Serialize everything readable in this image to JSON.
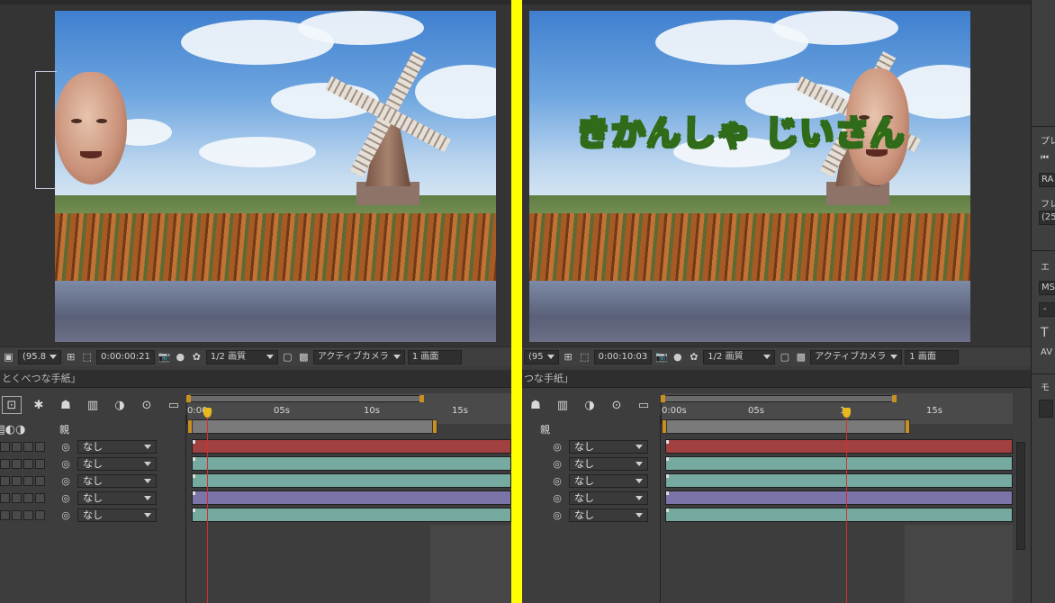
{
  "colors": {
    "separator": "#ffff00",
    "layer_red": "#a04040",
    "layer_teal": "#76aaa0",
    "layer_purple": "#7a74a8",
    "playhead": "#d32f2f",
    "handle": "#c8901f"
  },
  "left": {
    "toolbar": {
      "zoom": "(95.8",
      "timecode": "0:00:00:21",
      "resolution": "1/2 画質",
      "camera": "アクティブカメラ",
      "views": "1 画面"
    },
    "tab_label": "とくべつな手紙」",
    "timeline": {
      "parent_header": "親",
      "ruler_start": "0:00s",
      "ticks": [
        "05s",
        "10s",
        "15s"
      ],
      "layers": [
        {
          "parent": "なし",
          "color": "red"
        },
        {
          "parent": "なし",
          "color": "teal"
        },
        {
          "parent": "なし",
          "color": "teal"
        },
        {
          "parent": "なし",
          "color": "purple"
        },
        {
          "parent": "なし",
          "color": "teal"
        }
      ]
    }
  },
  "right": {
    "overlay_text": "きかんしゃ じいさん",
    "toolbar": {
      "zoom": "(95",
      "timecode": "0:00:10:03",
      "resolution": "1/2 画質",
      "camera": "アクティブカメラ",
      "views": "1 画面"
    },
    "tab_label": "つな手紙」",
    "timeline": {
      "parent_header": "親",
      "ruler_start": "0:00s",
      "ticks": [
        "05s",
        "1",
        "15s"
      ],
      "layers": [
        {
          "parent": "なし",
          "color": "red"
        },
        {
          "parent": "なし",
          "color": "teal"
        },
        {
          "parent": "なし",
          "color": "teal"
        },
        {
          "parent": "なし",
          "color": "purple"
        },
        {
          "parent": "なし",
          "color": "teal"
        }
      ]
    }
  },
  "side_panel": {
    "labels": [
      "プレ",
      "RA",
      "フレ",
      "(25",
      "エ",
      "MS",
      "-",
      "T",
      "AV",
      "モ"
    ]
  }
}
